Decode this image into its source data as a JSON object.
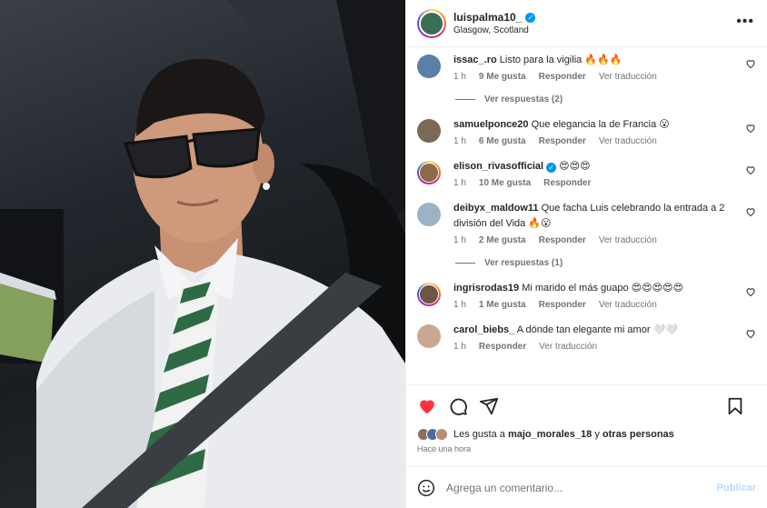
{
  "post": {
    "image_alt": "Selfie en el coche con gafas de sol, camisa blanca y corbata a rayas"
  },
  "header": {
    "username": "luispalma10_",
    "verified": true,
    "location": "Glasgow, Scotland",
    "more_icon": "more-horizontal-icon"
  },
  "comments": [
    {
      "user": "issac_.ro",
      "text": "Listo para la vigilia 🔥🔥🔥",
      "time": "1 h",
      "likes": "9 Me gusta",
      "reply": "Responder",
      "translate": "Ver traducción",
      "replies": "Ver respuestas (2)",
      "avatar_color": "#5a7fa8",
      "story": false
    },
    {
      "user": "samuelponce20",
      "text": "Que elegancia la de Francia 😮",
      "time": "1 h",
      "likes": "6 Me gusta",
      "reply": "Responder",
      "translate": "Ver traducción",
      "replies": "",
      "avatar_color": "#7a6a55",
      "story": false
    },
    {
      "user": "elison_rivasofficial",
      "verified": true,
      "text": "😍😍😍",
      "time": "1 h",
      "likes": "10 Me gusta",
      "reply": "Responder",
      "translate": "",
      "replies": "",
      "avatar_color": "#8b6b4a",
      "story": true
    },
    {
      "user": "deibyx_maldow11",
      "text": "Que facha Luis celebrando la entrada a 2 división del Vida 🔥😮",
      "time": "1 h",
      "likes": "2 Me gusta",
      "reply": "Responder",
      "translate": "Ver traducción",
      "replies": "Ver respuestas (1)",
      "avatar_color": "#9bb3c4",
      "story": false
    },
    {
      "user": "ingrisrodas19",
      "text": "Mi marido el más guapo 😍😍😍😍😍",
      "time": "1 h",
      "likes": "1 Me gusta",
      "reply": "Responder",
      "translate": "Ver traducción",
      "replies": "",
      "avatar_color": "#6e5544",
      "story": true
    },
    {
      "user": "carol_biebs_",
      "text": "A dónde tan elegante mi amor 🤍🤍",
      "time": "1 h",
      "likes": "",
      "reply": "Responder",
      "translate": "Ver traducción",
      "replies": "",
      "avatar_color": "#c9a892",
      "story": false
    }
  ],
  "actions": {
    "like_icon": "heart-filled-icon",
    "comment_icon": "comment-icon",
    "share_icon": "share-icon",
    "save_icon": "bookmark-icon",
    "like_color": "#ff3040"
  },
  "likes": {
    "prefix": "Les gusta a ",
    "user": "majo_morales_18",
    "suffix": " y ",
    "others": "otras personas"
  },
  "timestamp": "Hace una hora",
  "composer": {
    "emoji_icon": "emoji-icon",
    "placeholder": "Agrega un comentario...",
    "publish": "Publicar"
  },
  "colors": {
    "accent": "#0095f6",
    "text": "#262626",
    "muted": "#737373",
    "publish_disabled": "#b3dbff"
  }
}
